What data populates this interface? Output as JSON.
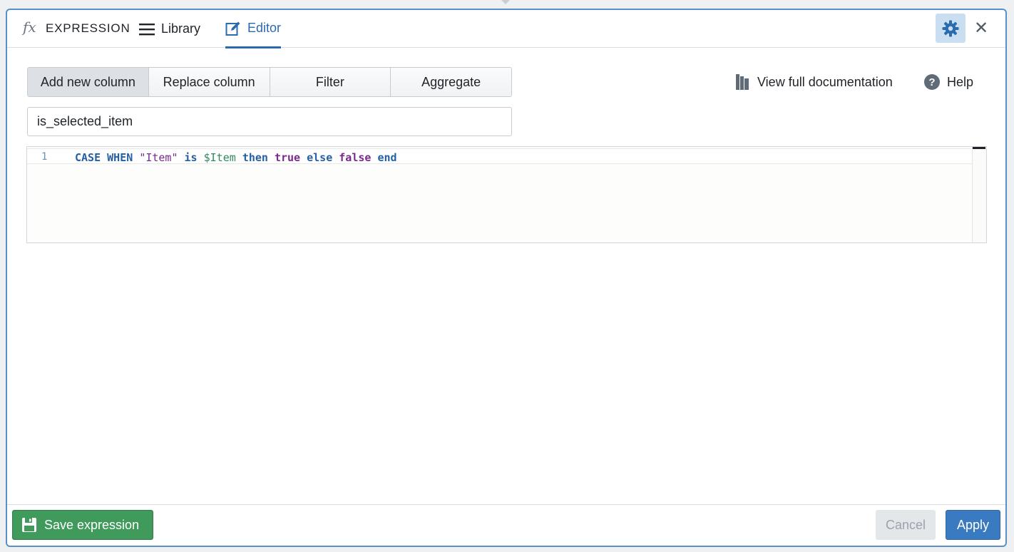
{
  "header": {
    "title": "EXPRESSION",
    "tabs": [
      {
        "label": "Library",
        "icon": "menu-icon"
      },
      {
        "label": "Editor",
        "icon": "edit-icon",
        "active": true
      }
    ],
    "settings_icon": "gear-icon",
    "close_icon": "close-icon",
    "close_glyph": "✕"
  },
  "mode_tabs": {
    "items": [
      {
        "label": "Add new column",
        "active": true
      },
      {
        "label": "Replace column"
      },
      {
        "label": "Filter"
      },
      {
        "label": "Aggregate"
      }
    ]
  },
  "links": {
    "documentation": "View full documentation",
    "help": "Help",
    "help_glyph": "?"
  },
  "column_name": {
    "value": "is_selected_item"
  },
  "editor": {
    "line_number": "1",
    "tokens": {
      "case_kw": "CASE",
      "when_kw": "WHEN",
      "string": "\"Item\"",
      "is_kw": "is",
      "variable": "$Item",
      "then_kw": "then",
      "true_kw": "true",
      "else_kw": "else",
      "false_kw": "false",
      "end_kw": "end"
    }
  },
  "footer": {
    "save_label": "Save expression",
    "cancel_label": "Cancel",
    "apply_label": "Apply"
  },
  "colors": {
    "accent": "#2a6bb0",
    "panel_border": "#5a8fc7",
    "save_green": "#3f9a5c",
    "apply_blue": "#3a7ac0",
    "keyword_blue": "#2560a4",
    "keyword_purple": "#7a2a8c",
    "variable_green": "#2f8a5a"
  }
}
